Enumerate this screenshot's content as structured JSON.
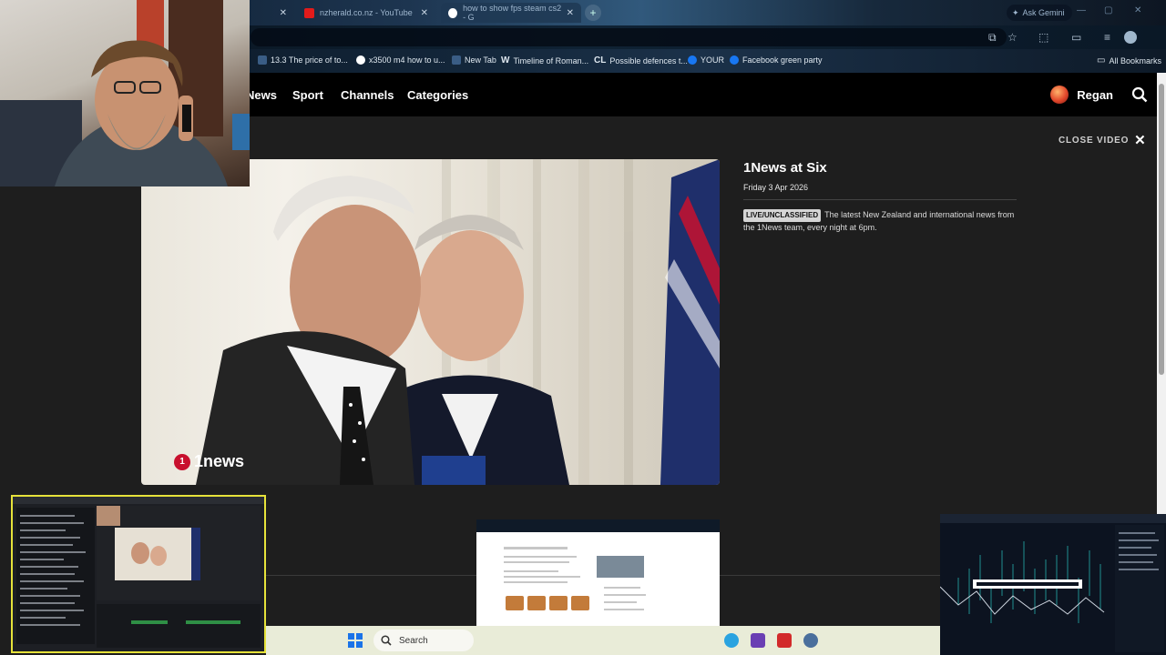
{
  "browser": {
    "tabs": [
      {
        "title": "",
        "active": false
      },
      {
        "title": "nzherald.co.nz - YouTube",
        "active": false
      },
      {
        "title": "how to show fps steam cs2 - G",
        "active": true
      }
    ],
    "new_tab_label": "+",
    "gemini_label": "Ask Gemini"
  },
  "bookmarks": {
    "items": [
      {
        "label": "13.3 The price of to...",
        "icon": "page-icon"
      },
      {
        "label": "x3500 m4 how to u...",
        "icon": "google-icon"
      },
      {
        "label": "New Tab",
        "icon": "page-icon"
      },
      {
        "label": "Timeline of Roman...",
        "icon": "wikipedia-icon"
      },
      {
        "label": "Possible defences t...",
        "icon": "cl-icon"
      },
      {
        "label": "YOUR",
        "icon": "facebook-icon"
      },
      {
        "label": "Facebook green party",
        "icon": "facebook-icon"
      }
    ],
    "all_bookmarks": "All Bookmarks"
  },
  "site": {
    "nav": [
      "News",
      "Sport",
      "Channels",
      "Categories"
    ],
    "user_name": "Regan",
    "close_video": "CLOSE VIDEO"
  },
  "video": {
    "brand_logo": "1news",
    "brand_number": "1"
  },
  "episode": {
    "title": "1News at Six",
    "date": "Friday 3 Apr 2026",
    "badge": "LIVE/UNCLASSIFIED",
    "description": "The latest New Zealand and international news from the 1News team, every night at 6pm."
  },
  "taskbar": {
    "search_placeholder": "Search"
  },
  "colors": {
    "nav_bg": "#000000",
    "page_bg": "#1e1e1e",
    "brand_red": "#c8102e",
    "accent_yellow": "#e6e23a"
  }
}
